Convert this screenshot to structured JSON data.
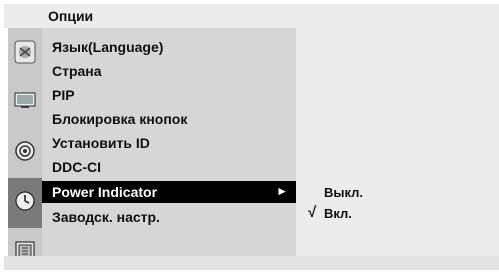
{
  "header": {
    "title": "Опции"
  },
  "sidebar": {
    "icons": [
      {
        "name": "picture-icon",
        "selected": false
      },
      {
        "name": "audio-icon",
        "selected": false
      },
      {
        "name": "timer-icon",
        "selected": false
      },
      {
        "name": "options-icon",
        "selected": true
      },
      {
        "name": "lock-icon",
        "selected": false
      }
    ]
  },
  "menu": {
    "items": [
      {
        "label": "Язык(Language)"
      },
      {
        "label": "Страна"
      },
      {
        "label": "PIP"
      },
      {
        "label": "Блокировка кнопок"
      },
      {
        "label": "Установить ID"
      },
      {
        "label": "DDC-CI"
      },
      {
        "label": "Power Indicator",
        "selected": true,
        "arrow": "►"
      },
      {
        "label": "Заводск. настр."
      }
    ]
  },
  "submenu": {
    "items": [
      {
        "label": "Выкл.",
        "checked": false
      },
      {
        "label": "Вкл.",
        "checked": true
      }
    ],
    "check_mark": "√"
  },
  "colors": {
    "highlight_bg": "#000000",
    "highlight_fg": "#ffffff",
    "menu_bg": "#d6d6d6",
    "icon_bg": "#c9c9c9",
    "icon_selected_bg": "#7a7a7a"
  }
}
